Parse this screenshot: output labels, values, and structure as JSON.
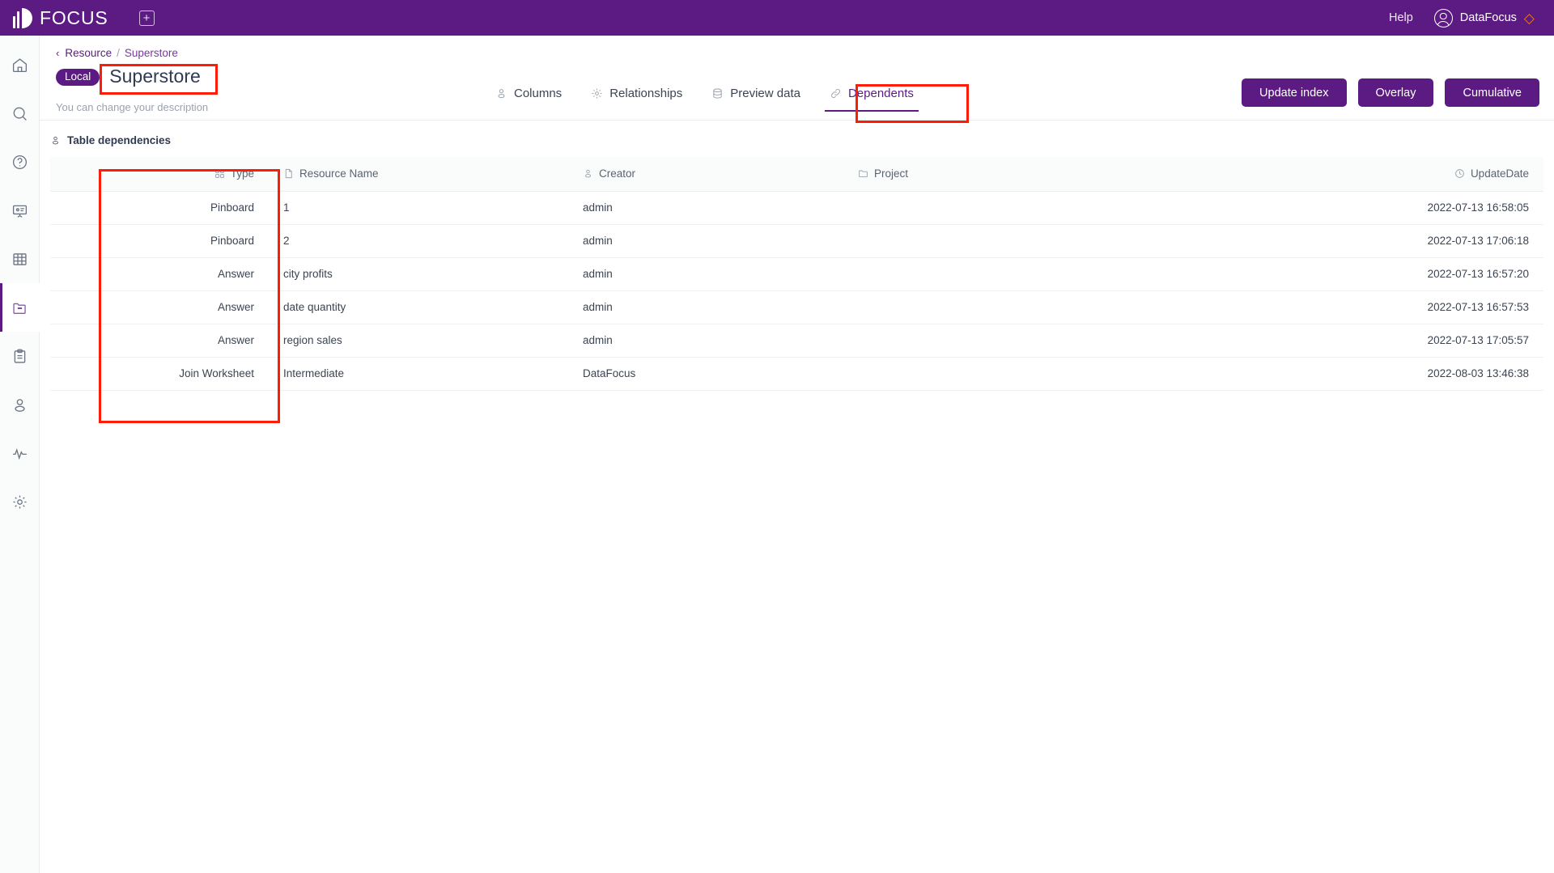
{
  "topbar": {
    "logo_text": "FOCUS",
    "add_icon": "plus-square-icon",
    "help_label": "Help",
    "user_name": "DataFocus",
    "user_icon": "user-circle-icon",
    "badge_icon": "diamond-badge-icon",
    "background_color": "#5c1a83"
  },
  "sidebar": {
    "items": [
      {
        "name": "home",
        "icon": "home-icon",
        "active": false
      },
      {
        "name": "search",
        "icon": "search-icon",
        "active": false
      },
      {
        "name": "help",
        "icon": "question-circle-icon",
        "active": false
      },
      {
        "name": "pinboard",
        "icon": "presentation-icon",
        "active": false
      },
      {
        "name": "table",
        "icon": "grid-table-icon",
        "active": false
      },
      {
        "name": "resource",
        "icon": "folder-minus-icon",
        "active": true
      },
      {
        "name": "tasks",
        "icon": "clipboard-icon",
        "active": false
      },
      {
        "name": "users",
        "icon": "user-icon",
        "active": false
      },
      {
        "name": "monitor",
        "icon": "activity-pulse-icon",
        "active": false
      },
      {
        "name": "settings",
        "icon": "gear-icon",
        "active": false
      }
    ]
  },
  "breadcrumb": {
    "back_icon": "chevron-left-icon",
    "parent": "Resource",
    "separator": "/",
    "current": "Superstore"
  },
  "header": {
    "badge": "Local",
    "title": "Superstore",
    "description": "You can change your description"
  },
  "tabs": [
    {
      "label": "Columns",
      "icon": "columns-icon",
      "active": false
    },
    {
      "label": "Relationships",
      "icon": "relationships-icon",
      "active": false
    },
    {
      "label": "Preview data",
      "icon": "database-icon",
      "active": false
    },
    {
      "label": "Dependents",
      "icon": "link-icon",
      "active": true
    }
  ],
  "actions": [
    {
      "label": "Update index"
    },
    {
      "label": "Overlay"
    },
    {
      "label": "Cumulative"
    }
  ],
  "section": {
    "icon": "dependencies-icon",
    "title": "Table dependencies"
  },
  "table": {
    "columns": [
      {
        "key": "type",
        "label": "Type",
        "icon": "type-icon"
      },
      {
        "key": "resource",
        "label": "Resource Name",
        "icon": "file-icon"
      },
      {
        "key": "creator",
        "label": "Creator",
        "icon": "user-icon"
      },
      {
        "key": "project",
        "label": "Project",
        "icon": "folder-icon"
      },
      {
        "key": "date",
        "label": "UpdateDate",
        "icon": "clock-icon"
      }
    ],
    "rows": [
      {
        "type": "Pinboard",
        "resource": "1",
        "creator": "admin",
        "project": "",
        "date": "2022-07-13 16:58:05"
      },
      {
        "type": "Pinboard",
        "resource": "2",
        "creator": "admin",
        "project": "",
        "date": "2022-07-13 17:06:18"
      },
      {
        "type": "Answer",
        "resource": "city profits",
        "creator": "admin",
        "project": "",
        "date": "2022-07-13 16:57:20"
      },
      {
        "type": "Answer",
        "resource": "date quantity",
        "creator": "admin",
        "project": "",
        "date": "2022-07-13 16:57:53"
      },
      {
        "type": "Answer",
        "resource": "region sales",
        "creator": "admin",
        "project": "",
        "date": "2022-07-13 17:05:57"
      },
      {
        "type": "Join Worksheet",
        "resource": "Intermediate",
        "creator": "DataFocus",
        "project": "",
        "date": "2022-08-03 13:46:38"
      }
    ]
  },
  "annotations": {
    "color": "#fc1c08",
    "boxes": [
      {
        "name": "title-highlight"
      },
      {
        "name": "dependents-tab-highlight"
      },
      {
        "name": "type-column-highlight"
      }
    ]
  },
  "colors": {
    "brand_purple": "#5c1a83",
    "annotation_red": "#fc1c08",
    "sidebar_bg": "#fafbfb",
    "text_dark": "#3b4453"
  }
}
